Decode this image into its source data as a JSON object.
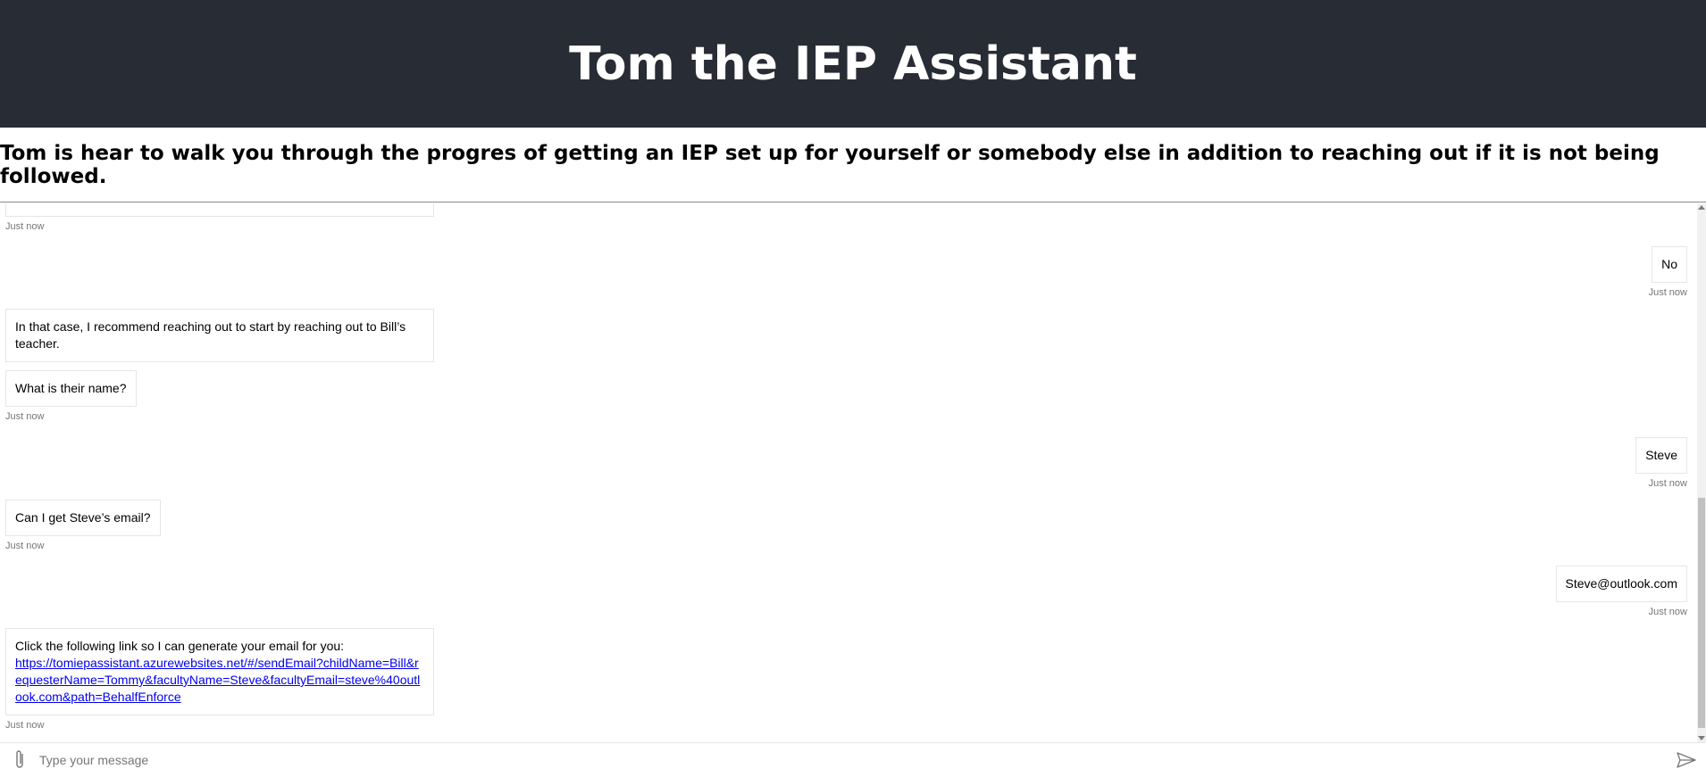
{
  "header": {
    "title": "Tom the IEP Assistant"
  },
  "subheader": {
    "text": "Tom is hear to walk you through the progres of getting an IEP set up for yourself or somebody else in addition to reaching out if it is not being followed."
  },
  "messages": [
    {
      "from": "bot",
      "text": "",
      "timestamp": "Just now"
    },
    {
      "from": "user",
      "text": "No",
      "timestamp": "Just now"
    },
    {
      "from": "bot",
      "text": "In that case, I recommend reaching out to start by reaching out to Bill’s teacher.",
      "timestamp": ""
    },
    {
      "from": "bot",
      "text": "What is their name?",
      "timestamp": "Just now"
    },
    {
      "from": "user",
      "text": "Steve",
      "timestamp": "Just now"
    },
    {
      "from": "bot",
      "text": "Can I get Steve’s email?",
      "timestamp": "Just now"
    },
    {
      "from": "user",
      "text": "Steve@outlook.com",
      "timestamp": "Just now"
    },
    {
      "from": "bot",
      "text": "Click the following link so I can generate your email for you:",
      "link": "https://tomiepassistant.azurewebsites.net/#/sendEmail?childName=Bill&requesterName=Tommy&facultyName=Steve&facultyEmail=steve%40outlook.com&path=BehalfEnforce",
      "timestamp": "Just now"
    }
  ],
  "composer": {
    "placeholder": "Type your message"
  },
  "icons": {
    "attach": "paperclip-icon",
    "send": "send-icon"
  },
  "colors": {
    "header_bg": "#282c34",
    "header_text": "#ffffff",
    "link": "#0000ee",
    "timestamp": "#767676"
  }
}
